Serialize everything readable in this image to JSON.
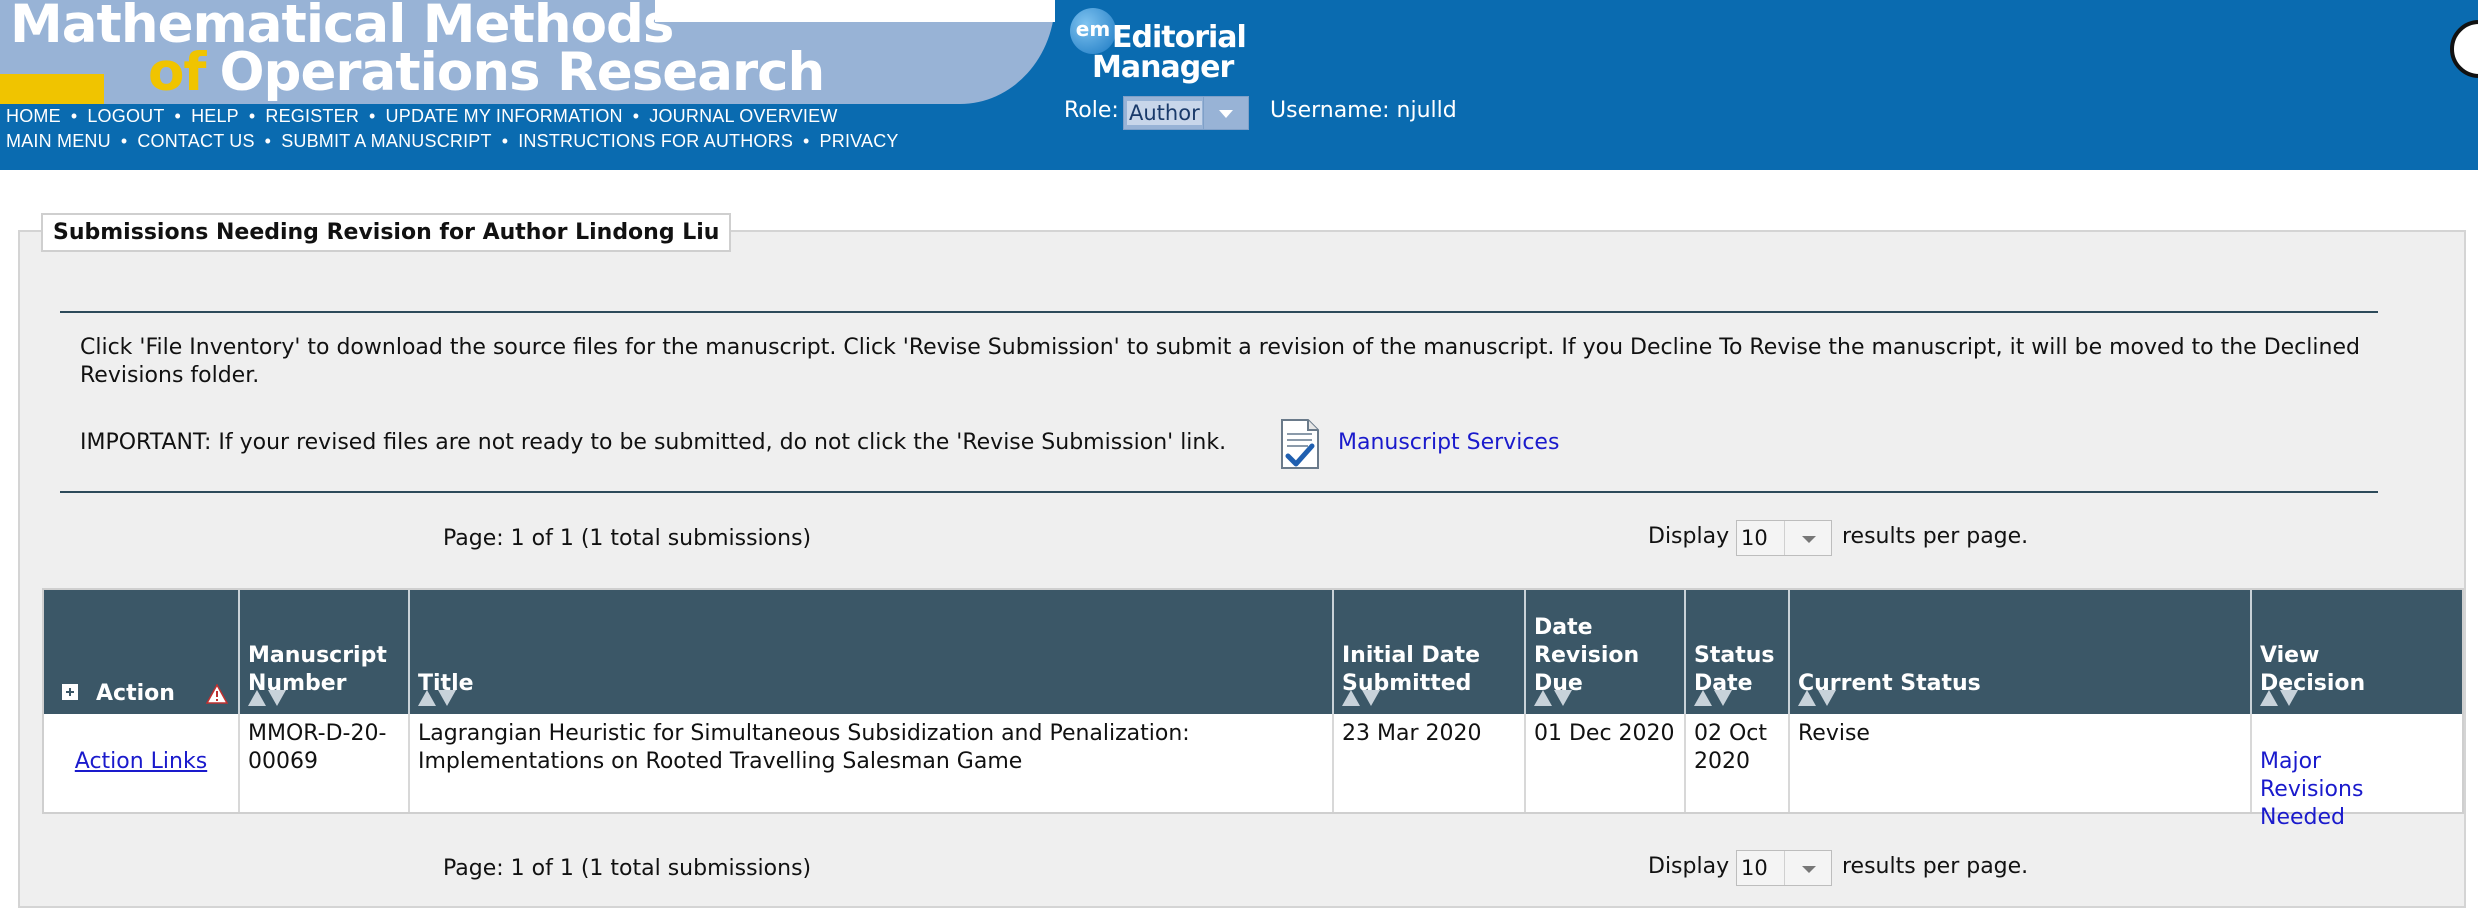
{
  "header": {
    "journal_title_line1": "Mathematical Methods",
    "journal_title_of": "of",
    "journal_title_line2": "Operations Research",
    "nav_row1": [
      "HOME",
      "LOGOUT",
      "HELP",
      "REGISTER",
      "UPDATE MY INFORMATION",
      "JOURNAL OVERVIEW"
    ],
    "nav_row2": [
      "MAIN MENU",
      "CONTACT US",
      "SUBMIT A MANUSCRIPT",
      "INSTRUCTIONS FOR AUTHORS",
      "PRIVACY"
    ],
    "logo_em": "em",
    "logo_line1": "Editorial",
    "logo_line2": "Manager",
    "role_label": "Role:",
    "role_value": "Author",
    "username": "Username: njulld",
    "colors": {
      "header_bg": "#0a6bb0",
      "banner": "#98b3d6",
      "accent_yellow": "#f0c400"
    }
  },
  "panel": {
    "legend": "Submissions Needing Revision for Author Lindong Liu",
    "instructions": "Click 'File Inventory' to download the source files for the manuscript. Click 'Revise Submission' to submit a revision of the manuscript. If you Decline To Revise the manuscript, it will be moved to the Declined Revisions folder.",
    "important": "IMPORTANT: If your revised files are not ready to be submitted, do not click the 'Revise Submission' link.",
    "manuscript_services": "Manuscript Services",
    "pager": {
      "page_info": "Page: 1 of 1 (1 total submissions)",
      "display_label": "Display",
      "display_value": "10",
      "results_label": "results per page."
    }
  },
  "table": {
    "headers": {
      "action": "Action",
      "manuscript_number": "Manuscript\nNumber",
      "title": "Title",
      "initial_date": "Initial Date\nSubmitted",
      "revision_due": "Date\nRevision\nDue",
      "status_date": "Status\nDate",
      "current_status": "Current Status",
      "view_decision": "View\nDecision"
    },
    "rows": [
      {
        "action": "Action Links",
        "manuscript_number": "MMOR-D-20-\n00069",
        "title": "Lagrangian Heuristic for Simultaneous Subsidization and Penalization:\nImplementations on Rooted Travelling Salesman Game",
        "initial_date": "23 Mar 2020",
        "revision_due": "01 Dec 2020",
        "status_date": "02 Oct\n2020",
        "current_status": "Revise",
        "view_decision": "Major\nRevisions\nNeeded"
      }
    ],
    "colors": {
      "header_bg": "#3b5767",
      "link": "#1a1acc"
    }
  },
  "icons": [
    "expand-icon",
    "warning-icon",
    "document-check-icon",
    "sort-up-icon",
    "sort-down-icon",
    "dropdown-arrow-icon"
  ]
}
